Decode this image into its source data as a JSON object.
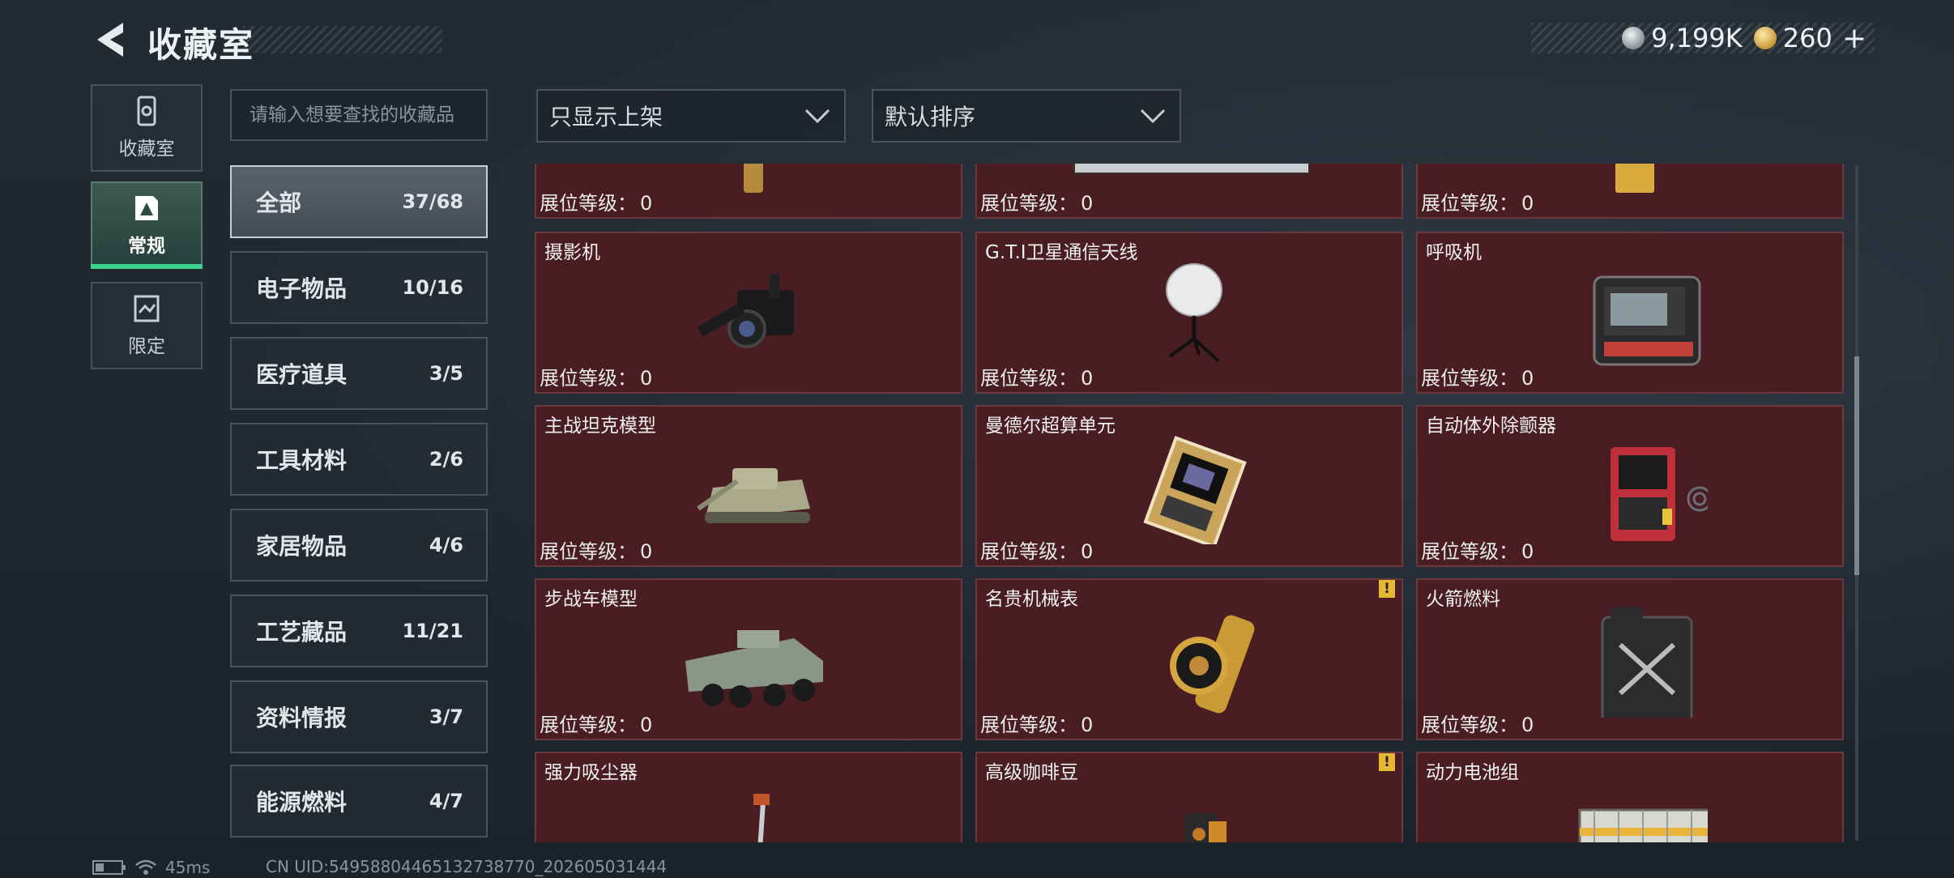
{
  "header": {
    "title": "收藏室",
    "currency": [
      {
        "icon": "silver-coin-icon",
        "value": "9,199K"
      },
      {
        "icon": "gold-coin-icon",
        "value": "260"
      }
    ],
    "plus": "+"
  },
  "nav": {
    "items": [
      {
        "label": "收藏室",
        "icon": "collection-icon"
      },
      {
        "label": "常规",
        "icon": "regular-icon",
        "active": true
      },
      {
        "label": "限定",
        "icon": "limited-icon"
      }
    ]
  },
  "search": {
    "placeholder": "请输入想要查找的收藏品"
  },
  "categories": [
    {
      "name": "全部",
      "count": "37/68",
      "active": true
    },
    {
      "name": "电子物品",
      "count": "10/16"
    },
    {
      "name": "医疗道具",
      "count": "3/5"
    },
    {
      "name": "工具材料",
      "count": "2/6"
    },
    {
      "name": "家居物品",
      "count": "4/6"
    },
    {
      "name": "工艺藏品",
      "count": "11/21"
    },
    {
      "name": "资料情报",
      "count": "3/7"
    },
    {
      "name": "能源燃料",
      "count": "4/7"
    }
  ],
  "filters": {
    "filter1": "只显示上架",
    "filter2": "默认排序"
  },
  "level_label": "展位等级：",
  "items": [
    {
      "name": "",
      "level": "0"
    },
    {
      "name": "",
      "level": "0"
    },
    {
      "name": "",
      "level": "0"
    },
    {
      "name": "摄影机",
      "level": "0"
    },
    {
      "name": "G.T.I卫星通信天线",
      "level": "0"
    },
    {
      "name": "呼吸机",
      "level": "0"
    },
    {
      "name": "主战坦克模型",
      "level": "0"
    },
    {
      "name": "曼德尔超算单元",
      "level": "0"
    },
    {
      "name": "自动体外除颤器",
      "level": "0"
    },
    {
      "name": "步战车模型",
      "level": "0"
    },
    {
      "name": "名贵机械表",
      "level": "0",
      "warning": true
    },
    {
      "name": "火箭燃料",
      "level": "0"
    },
    {
      "name": "强力吸尘器",
      "level": ""
    },
    {
      "name": "高级咖啡豆",
      "level": "",
      "warning": true
    },
    {
      "name": "动力电池组",
      "level": ""
    }
  ],
  "warning_mark": "!",
  "status": {
    "ping": "45ms",
    "uid": "CN UID:5495880446513273​8770_202605031444"
  },
  "colors": {
    "card_bg": "#4a1d22",
    "accent_green": "#39d28f",
    "warning": "#e5b734"
  }
}
